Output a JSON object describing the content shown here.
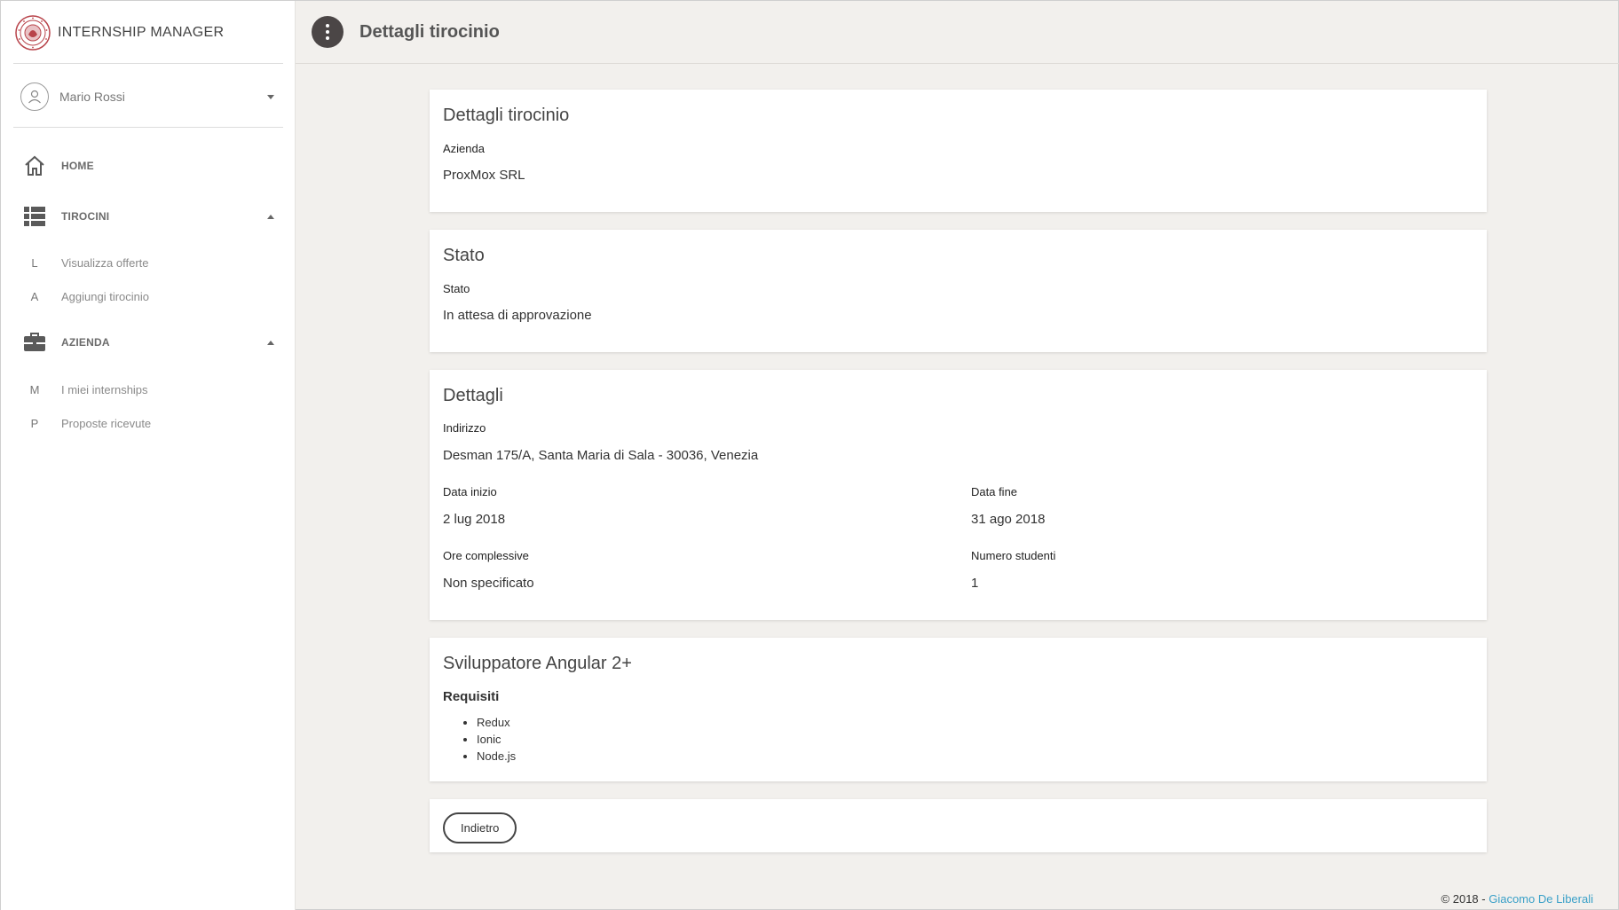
{
  "app": {
    "title": "INTERNSHIP MANAGER"
  },
  "user": {
    "name": "Mario Rossi"
  },
  "sidebar": {
    "home": "HOME",
    "tirocini": {
      "label": "TIROCINI",
      "items": [
        {
          "letter": "L",
          "label": "Visualizza offerte"
        },
        {
          "letter": "A",
          "label": "Aggiungi tirocinio"
        }
      ]
    },
    "azienda": {
      "label": "AZIENDA",
      "items": [
        {
          "letter": "M",
          "label": "I miei internships"
        },
        {
          "letter": "P",
          "label": "Proposte ricevute"
        }
      ]
    }
  },
  "header": {
    "title": "Dettagli tirocinio"
  },
  "card_details": {
    "title": "Dettagli tirocinio",
    "company_label": "Azienda",
    "company_value": "ProxMox SRL"
  },
  "card_status": {
    "title": "Stato",
    "status_label": "Stato",
    "status_value": "In attesa di approvazione"
  },
  "card_info": {
    "title": "Dettagli",
    "address_label": "Indirizzo",
    "address_value": "Desman 175/A, Santa Maria di Sala - 30036, Venezia",
    "start_label": "Data inizio",
    "start_value": "2 lug 2018",
    "end_label": "Data fine",
    "end_value": "31 ago 2018",
    "hours_label": "Ore complessive",
    "hours_value": "Non specificato",
    "students_label": "Numero studenti",
    "students_value": "1"
  },
  "card_position": {
    "title": "Sviluppatore Angular 2+",
    "requirements_label": "Requisiti",
    "requirements": [
      "Redux",
      "Ionic",
      "Node.js"
    ]
  },
  "actions": {
    "back": "Indietro"
  },
  "footer": {
    "copyright": "© 2018 - ",
    "author": "Giacomo De Liberali"
  },
  "colors": {
    "link": "#3aa0c8",
    "menu_button": "#4b4646",
    "background": "#f2f0ed"
  }
}
